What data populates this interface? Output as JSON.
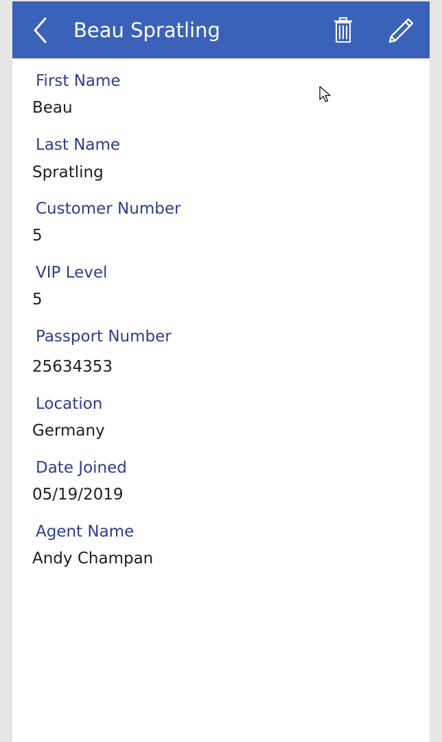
{
  "header": {
    "title": "Beau Spratling",
    "back_icon": "chevron-left-icon",
    "delete_icon": "trash-icon",
    "edit_icon": "pencil-icon",
    "color": "#3a62b8"
  },
  "fields": [
    {
      "label": "First Name",
      "value": "Beau"
    },
    {
      "label": "Last Name",
      "value": "Spratling"
    },
    {
      "label": "Customer Number",
      "value": "5"
    },
    {
      "label": "VIP Level",
      "value": "5"
    },
    {
      "label": "Passport Number",
      "value": "25634353"
    },
    {
      "label": "Location",
      "value": "Germany"
    },
    {
      "label": "Date Joined",
      "value": "05/19/2019"
    },
    {
      "label": "Agent Name",
      "value": "Andy Champan"
    }
  ],
  "colors": {
    "label": "#2d3e8c",
    "value": "#1e1e1e",
    "background": "#ffffff"
  }
}
